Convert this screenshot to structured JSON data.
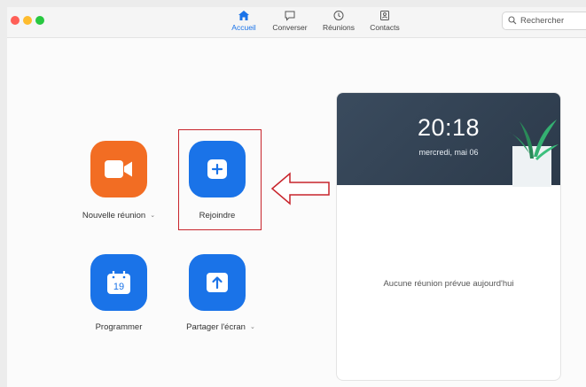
{
  "app": {
    "traffic_lights": {
      "close_color": "#ff5f57",
      "minimize_color": "#febc2e",
      "zoom_color": "#28c840"
    }
  },
  "nav": {
    "tabs": [
      {
        "label": "Accueil",
        "icon": "home-icon",
        "active": true
      },
      {
        "label": "Converser",
        "icon": "chat-bubble-icon",
        "active": false
      },
      {
        "label": "Réunions",
        "icon": "clock-icon",
        "active": false
      },
      {
        "label": "Contacts",
        "icon": "contact-card-icon",
        "active": false
      }
    ],
    "accent_color": "#1a73e8"
  },
  "search": {
    "placeholder": "Rechercher",
    "icon": "search-icon"
  },
  "actions": [
    {
      "label": "Nouvelle réunion",
      "icon": "video-camera-icon",
      "color": "#f26d23",
      "has_dropdown": true
    },
    {
      "label": "Rejoindre",
      "icon": "plus-icon",
      "color": "#1a73e8",
      "has_dropdown": false,
      "highlighted": true
    },
    {
      "label": "Programmer",
      "icon": "calendar-icon",
      "calendar_day": "19",
      "color": "#1a73e8",
      "has_dropdown": false
    },
    {
      "label": "Partager l'écran",
      "icon": "share-screen-icon",
      "color": "#1a73e8",
      "has_dropdown": true
    }
  ],
  "annotation": {
    "color": "#c8252c",
    "arrow_icon": "left-arrow-icon"
  },
  "meetings_panel": {
    "time": "20:18",
    "date": "mercredi, mai 06",
    "empty_message": "Aucune réunion prévue aujourd'hui",
    "banner_color": "#34455a",
    "decoration_icon": "plant-icon"
  }
}
